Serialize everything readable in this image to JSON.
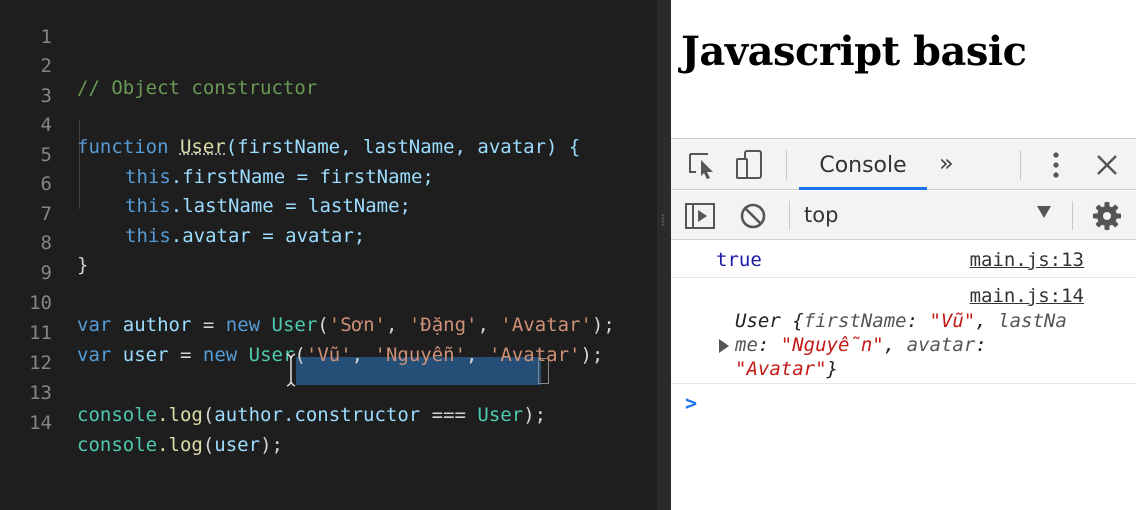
{
  "editor": {
    "line_numbers": [
      "1",
      "2",
      "3",
      "4",
      "5",
      "6",
      "7",
      "8",
      "9",
      "10",
      "11",
      "12",
      "13",
      "14"
    ],
    "comment": "// Object constructor",
    "kw_function": "function",
    "fn_user": "User",
    "params": "(firstName, lastName, avatar) {",
    "kw_this": "this",
    "body_1": ".firstName = firstName;",
    "body_2": ".lastName = lastName;",
    "body_3": ".avatar = avatar;",
    "close_brace": "}",
    "kw_var": "var",
    "kw_new": "new",
    "author": "author",
    "user": "user",
    "eq": " = ",
    "str_son": "'Sơn'",
    "str_dang": "'Đặng'",
    "str_avatar": "'Avatar'",
    "str_vu": "'Vũ'",
    "str_nguyen": "'Nguyễn'",
    "comma": ", ",
    "paren_open": "(",
    "paren_close_semi": ");",
    "console": "console",
    "log": ".log",
    "constructor": ".constructor",
    "triple_eq": " === ",
    "space": " "
  },
  "preview": {
    "heading": "Javascript basic"
  },
  "devtools": {
    "tab_console": "Console",
    "more_tabs": "»",
    "context": "top",
    "messages": [
      {
        "value": "true",
        "source": "main.js:13"
      },
      {
        "source": "main.js:14",
        "obj_line1_a": "User {",
        "obj_line1_k1": "firstName",
        "obj_colon": ": ",
        "obj_line1_v1": "\"Vũ\"",
        "obj_line1_sep": ", ",
        "obj_line1_k2": "lastNa",
        "obj_line2_k2": "me",
        "obj_line2_v2": "\"Nguyễn\"",
        "obj_line2_sep": ", ",
        "obj_line2_k3": "avatar",
        "obj_line2_colon": ":",
        "obj_line3_v3": "\"Avatar\"",
        "obj_line3_close": "}"
      }
    ],
    "prompt": ">"
  },
  "colors": {
    "editor_bg": "#1e1e1e",
    "keyword": "#569cd6",
    "function": "#dcdcaa",
    "type": "#4ec9b0",
    "variable": "#9cdcfe",
    "string": "#ce9178",
    "comment": "#6a9955",
    "selection": "#264f78",
    "accent": "#1a73e8"
  }
}
